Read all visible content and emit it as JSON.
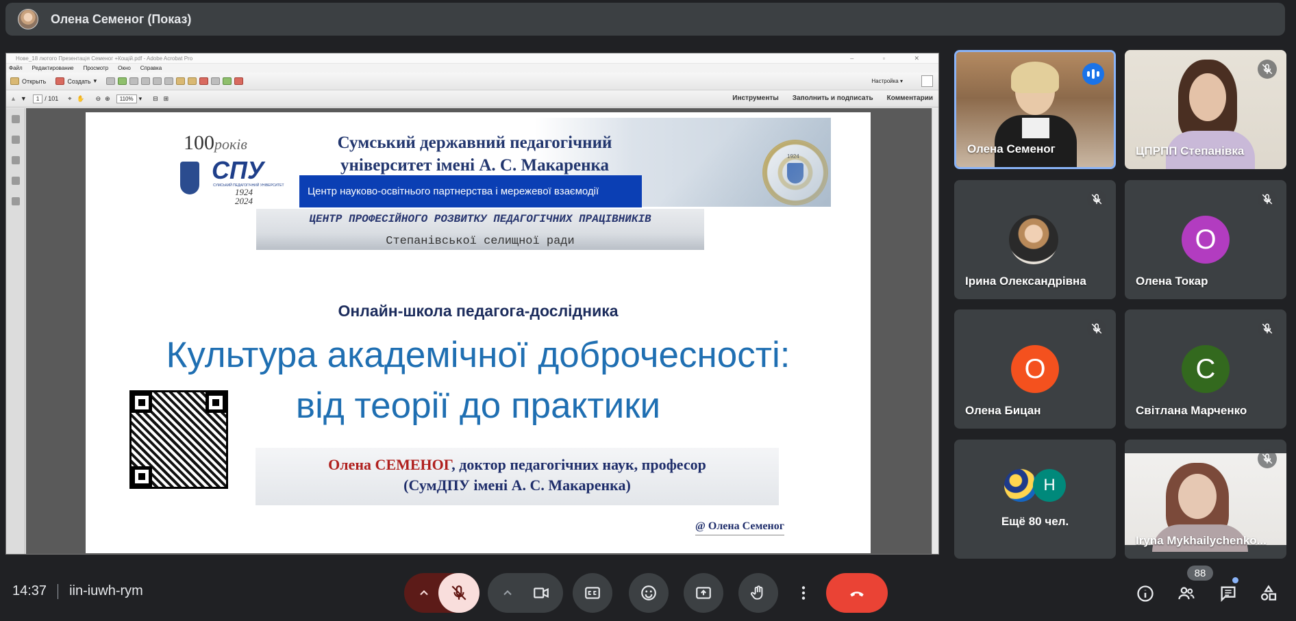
{
  "topbar": {
    "presenter_title": "Олена Семеног (Показ)"
  },
  "acrobat": {
    "window_title": "Нове_18 лютого Презентація Семеног +Кощій.pdf - Adobe Acrobat Pro",
    "menu": [
      "Файл",
      "Редактирование",
      "Просмотр",
      "Окно",
      "Справка"
    ],
    "open_label": "Открыть",
    "create_label": "Создать",
    "settings_label": "Настройка",
    "page_current": "1",
    "page_total": "/ 101",
    "zoom": "110%",
    "right_links": [
      "Инструменты",
      "Заполнить и подписать",
      "Комментарии"
    ]
  },
  "slide": {
    "years_text": "100",
    "rokiv": "років",
    "spu": "СПУ",
    "spu_sub": "СУМСЬКИЙ ПЕДАГОГІЧНИЙ УНІВЕРСИТЕТ",
    "years_range": "1924\n2024",
    "university": "Сумський державний педагогічний університет імені А. С. Макаренка",
    "seal_year": "1924",
    "banner": "Центр науково-освітнього партнерства і мережевої взаємодії",
    "centre_line1": "ЦЕНТР ПРОФЕСІЙНОГО РОЗВИТКУ ПЕДАГОГІЧНИХ ПРАЦІВНИКІВ",
    "centre_line2": "Степанівської селищної ради",
    "school": "Онлайн-школа педагога-дослідника",
    "title_line1": "Культура академічної доброчесності:",
    "title_line2": "від теорії до практики",
    "author_name": "Олена СЕМЕНОГ",
    "author_rest": ", доктор педагогічних наук, професор",
    "author_line2": "(СумДПУ імені А. С. Макаренка)",
    "copyright": "@ Олена Семеног"
  },
  "participants": [
    {
      "name": "Олена Семеног",
      "speaking": true
    },
    {
      "name": "ЦПРПП Степанівка",
      "muted": true
    },
    {
      "name": "Ірина Олександрівна",
      "muted": true
    },
    {
      "name": "Олена Токар",
      "letter": "О",
      "color": "#b23cc0",
      "muted": true
    },
    {
      "name": "Олена Бицан",
      "letter": "О",
      "color": "#f4511e",
      "muted": true
    },
    {
      "name": "Світлана Марченко",
      "letter": "С",
      "color": "#33691e",
      "muted": true
    },
    {
      "name": "Ещё 80 чел.",
      "letter": "Н",
      "color": "#00897b"
    },
    {
      "name": "Iryna Mykhailychenko...",
      "muted": true
    }
  ],
  "bottom": {
    "time": "14:37",
    "meeting_code": "iin-iuwh-rym",
    "people_count": "88",
    "colors": {
      "mic_off_bg": "#f9dedc",
      "end_call": "#ea4335",
      "accent": "#8ab4f8"
    }
  }
}
